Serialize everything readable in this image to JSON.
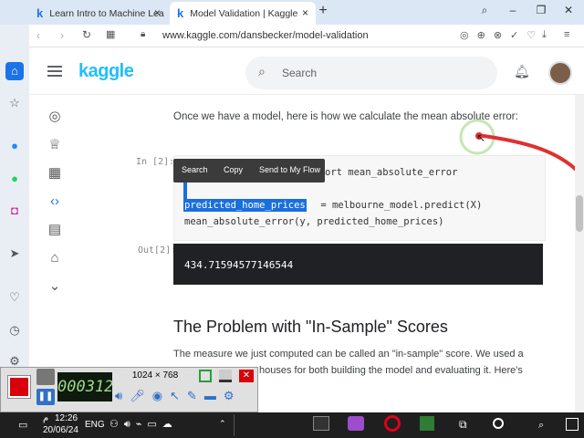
{
  "browser": {
    "tabs": [
      {
        "label": "Learn Intro to Machine Lea",
        "close": "×"
      },
      {
        "label": "Model Validation | Kaggle",
        "close": "×"
      }
    ],
    "new_tab": "+",
    "url": "www.kaggle.com/dansbecker/model-validation"
  },
  "kaggle": {
    "logo": "kaggle",
    "search_placeholder": "Search"
  },
  "notebook": {
    "intro": "Once we have a model, here is how we calculate the mean absolute error:",
    "in_label": "In [2]:",
    "code_line1_tail": "ort mean_absolute_error",
    "code_line2_selected": "predicted_home_prices",
    "code_line2_rest": " = melbourne_model.predict(X)",
    "code_line3": "mean_absolute_error(y, predicted_home_prices)",
    "out_label": "Out[2]:",
    "output": "434.71594577146544",
    "heading": "The Problem with \"In-Sample\" Scores",
    "para_line1": "The measure we just computed can be called an \"in-sample\" score. We used a",
    "para_line2": "houses for both building the model and evaluating it. Here's"
  },
  "context_popup": {
    "search": "Search",
    "copy": "Copy",
    "send": "Send to My Flow"
  },
  "recorder": {
    "timer": "000312",
    "resolution": "1024 × 768"
  },
  "taskbar": {
    "time": "12:26",
    "ampm": "م",
    "date": "20/06/24",
    "lang": "ENG"
  },
  "colors": {
    "kaggle_blue": "#20beff",
    "selection": "#1a6fdf",
    "opera_red": "#e0001b"
  }
}
